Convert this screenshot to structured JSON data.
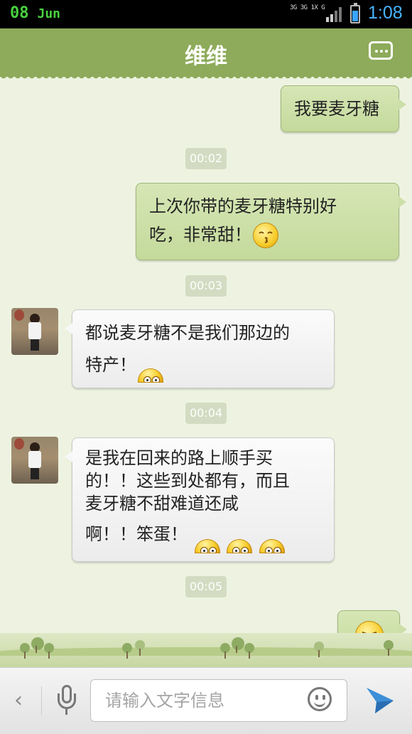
{
  "status_bar": {
    "day": "08",
    "month": "Jun",
    "network": [
      "3G",
      "3G",
      "1X",
      "G"
    ],
    "time": "1:08"
  },
  "header": {
    "title": "维维",
    "menu_icon": "more-dots-icon"
  },
  "messages": [
    {
      "from": "me",
      "text": "我要麦牙糖"
    },
    {
      "time": "00:02"
    },
    {
      "from": "me",
      "line1": "上次你带的麦牙糖特别好",
      "line2": "吃，非常甜！",
      "emoji": "smirk-icon"
    },
    {
      "time": "00:03"
    },
    {
      "from": "them",
      "line1": "都说麦牙糖不是我们那边的",
      "line2": "特产！",
      "emoji": "wide-eyes-icon"
    },
    {
      "time": "00:04"
    },
    {
      "from": "them",
      "line1": "是我在回来的路上顺手买",
      "line2": "的！！这些到处都有，而且",
      "line3": "麦牙糖不甜难道还咸",
      "line4": "啊！！笨蛋！",
      "emoji": "wide-eyes-icon"
    },
    {
      "time": "00:05"
    },
    {
      "from": "me",
      "emoji": "sweat-face-icon"
    }
  ],
  "input_bar": {
    "placeholder": "请输入文字信息",
    "icons": [
      "back-arrow-icon",
      "microphone-icon",
      "smiley-icon",
      "send-icon"
    ]
  },
  "colors": {
    "header": "#8dab5a",
    "background": "#eef3e1",
    "my_bubble": "#cddfa8",
    "their_bubble": "#f4f4f4",
    "time_accent": "#4ab3ff"
  }
}
